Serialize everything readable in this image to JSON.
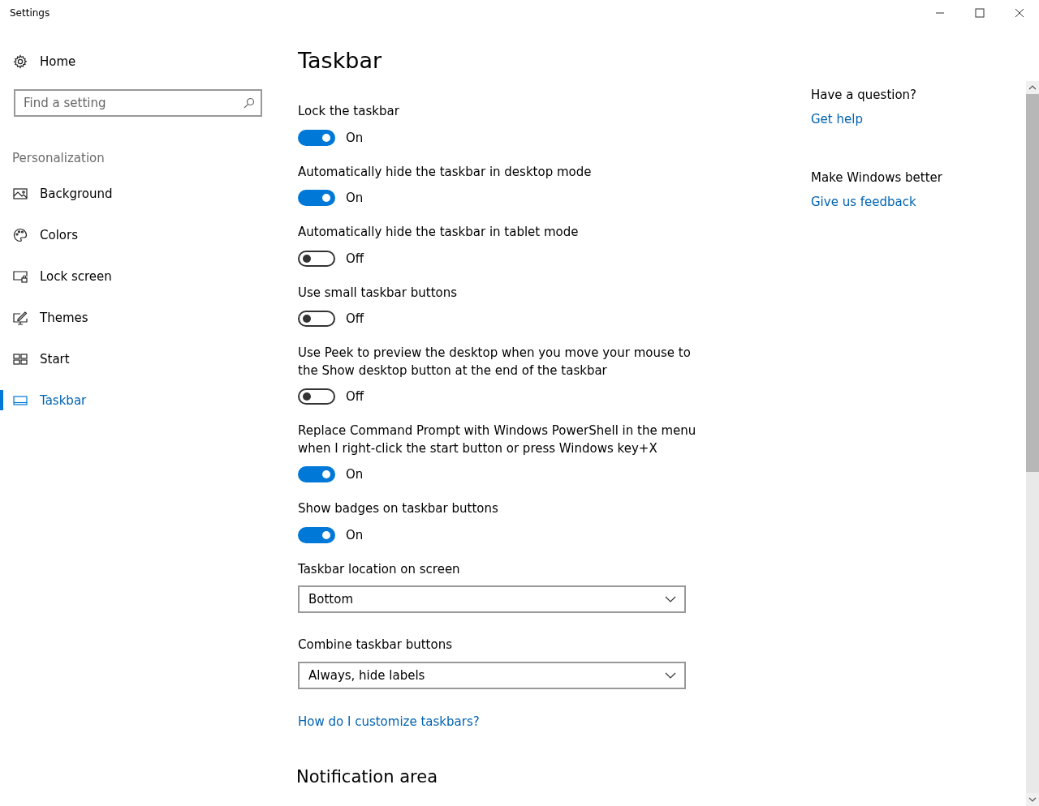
{
  "window": {
    "title": "Settings"
  },
  "sidebar": {
    "home": "Home",
    "search": {
      "placeholder": "Find a setting"
    },
    "section": "Personalization",
    "items": [
      {
        "label": "Background",
        "selected": false
      },
      {
        "label": "Colors",
        "selected": false
      },
      {
        "label": "Lock screen",
        "selected": false
      },
      {
        "label": "Themes",
        "selected": false
      },
      {
        "label": "Start",
        "selected": false
      },
      {
        "label": "Taskbar",
        "selected": true
      }
    ]
  },
  "main": {
    "title": "Taskbar",
    "settings": [
      {
        "kind": "toggle",
        "label": "Lock the taskbar",
        "on": true,
        "state": "On"
      },
      {
        "kind": "toggle",
        "label": "Automatically hide the taskbar in desktop mode",
        "on": true,
        "state": "On"
      },
      {
        "kind": "toggle",
        "label": "Automatically hide the taskbar in tablet mode",
        "on": false,
        "state": "Off"
      },
      {
        "kind": "toggle",
        "label": "Use small taskbar buttons",
        "on": false,
        "state": "Off"
      },
      {
        "kind": "toggle",
        "label": "Use Peek to preview the desktop when you move your mouse to the Show desktop button at the end of the taskbar",
        "on": false,
        "state": "Off"
      },
      {
        "kind": "toggle",
        "label": "Replace Command Prompt with Windows PowerShell in the menu when I right-click the start button or press Windows key+X",
        "on": true,
        "state": "On"
      },
      {
        "kind": "toggle",
        "label": "Show badges on taskbar buttons",
        "on": true,
        "state": "On"
      },
      {
        "kind": "dropdown",
        "label": "Taskbar location on screen",
        "value": "Bottom"
      },
      {
        "kind": "dropdown",
        "label": "Combine taskbar buttons",
        "value": "Always, hide labels"
      },
      {
        "kind": "link",
        "label": "How do I customize taskbars?"
      },
      {
        "kind": "heading",
        "label": "Notification area"
      }
    ]
  },
  "aside": [
    {
      "title": "Have a question?",
      "link": "Get help"
    },
    {
      "title": "Make Windows better",
      "link": "Give us feedback"
    }
  ]
}
